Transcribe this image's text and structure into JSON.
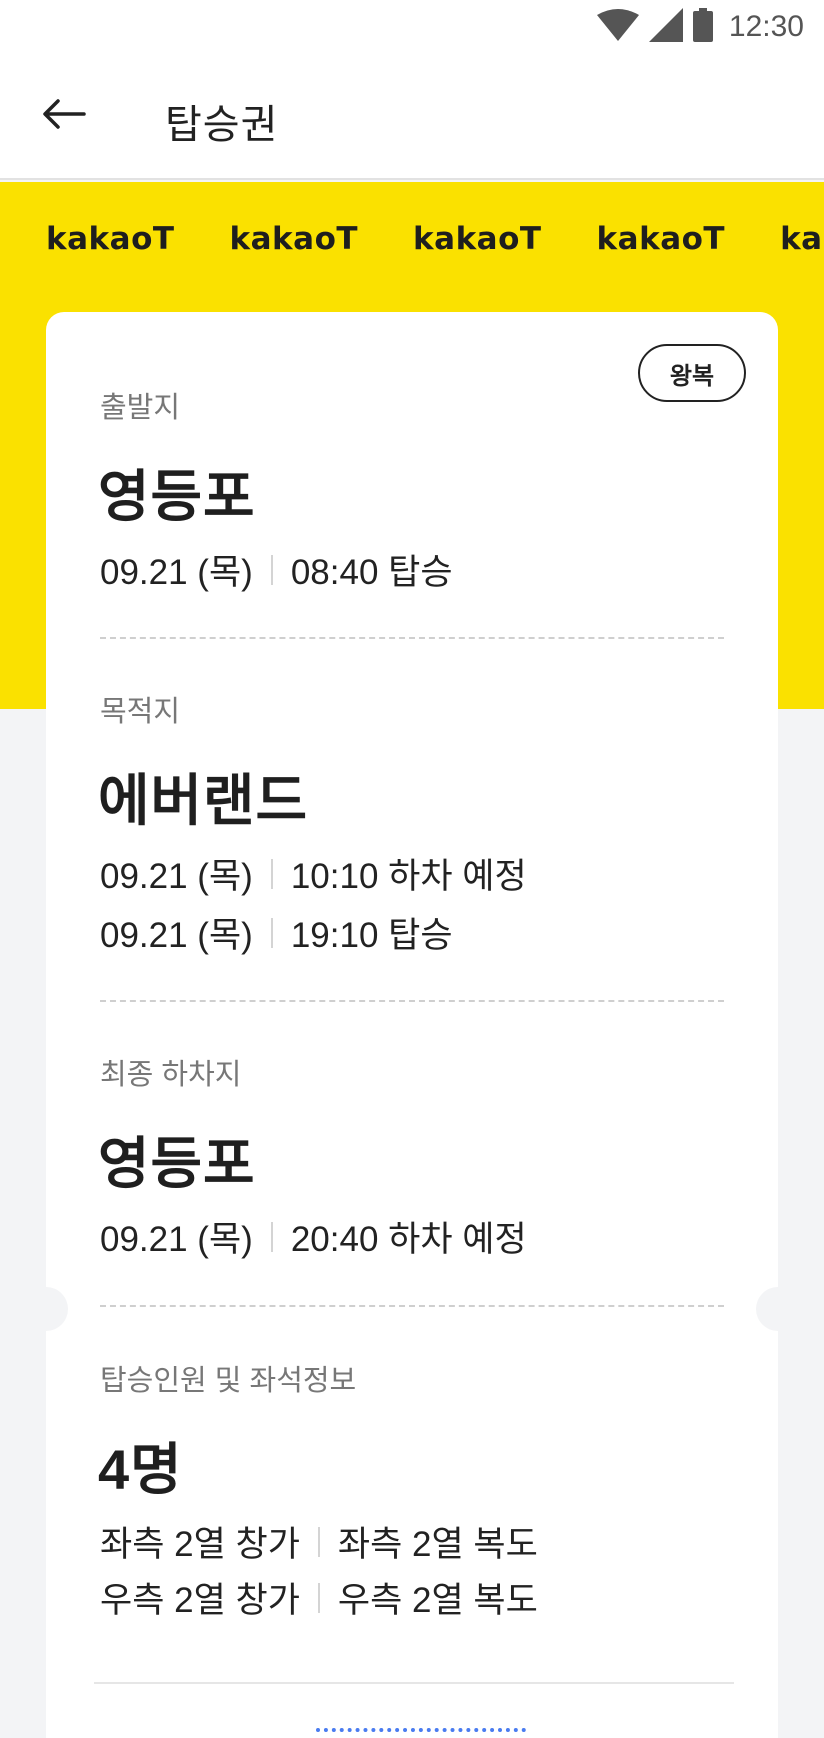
{
  "status_bar": {
    "time": "12:30"
  },
  "app_bar": {
    "title": "탑승권"
  },
  "brand": {
    "items": [
      "kakaoT",
      "kakaoT",
      "kakaoT",
      "kakaoT",
      "kakaoT"
    ]
  },
  "ticket": {
    "badge": "왕복",
    "departure": {
      "label": "출발지",
      "place": "영등포",
      "date": "09.21 (목)",
      "detail": "08:40 탑승"
    },
    "destination": {
      "label": "목적지",
      "place": "에버랜드",
      "rows": [
        {
          "date": "09.21 (목)",
          "detail": "10:10 하차 예정"
        },
        {
          "date": "09.21 (목)",
          "detail": "19:10 탑승"
        }
      ]
    },
    "final_stop": {
      "label": "최종 하차지",
      "place": "영등포",
      "date": "09.21 (목)",
      "detail": "20:40 하차 예정"
    },
    "passengers": {
      "label": "탑승인원 및 좌석정보",
      "count": "4명",
      "seats": [
        [
          "좌측 2열 창가",
          "좌측 2열 복도"
        ],
        [
          "우측 2열 창가",
          "우측 2열 복도"
        ]
      ]
    }
  },
  "colors": {
    "brand_yellow": "#fae100",
    "background": "#f3f4f6"
  }
}
